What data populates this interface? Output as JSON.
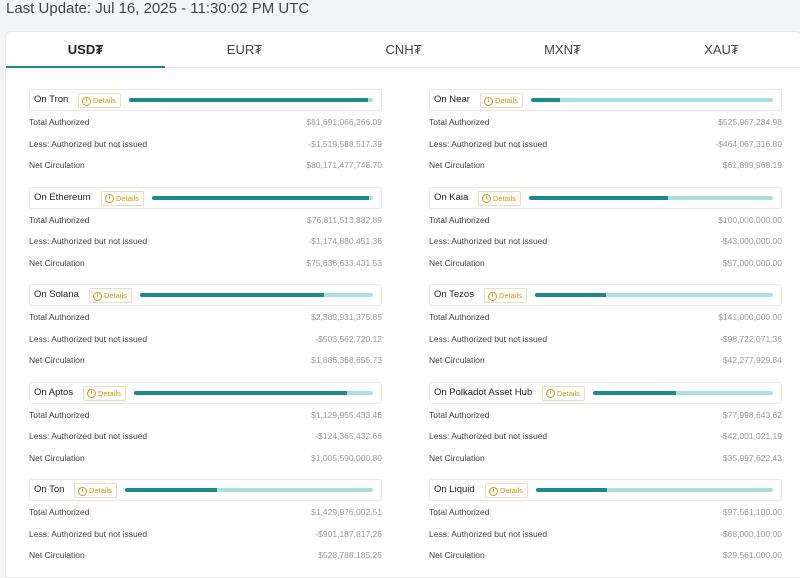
{
  "last_update": "Last Update: Jul 16, 2025 - 11:30:02 PM UTC",
  "tabs": [
    "USD₮",
    "EUR₮",
    "CNH₮",
    "MXN₮",
    "XAU₮"
  ],
  "active_tab": 0,
  "row_labels": {
    "total": "Total Authorized",
    "less": "Less: Authorized but not issued",
    "net": "Net Circulation"
  },
  "details_label": "Details",
  "colors": {
    "accent": "#1a8a8c",
    "accent_light": "#a9dfde",
    "details": "#c79a2e"
  },
  "chains_left": [
    {
      "name": "On Tron",
      "total": "$81,691,066,266.09",
      "less": "-$1,519,588,517.39",
      "net": "$80,171,477,748.70",
      "ratio": 0.98
    },
    {
      "name": "On Ethereum",
      "total": "$76,811,513,882.89",
      "less": "-$1,174,880,451.36",
      "net": "$75,636,633,431.53",
      "ratio": 0.98
    },
    {
      "name": "On Solana",
      "total": "$2,389,931,375.85",
      "less": "-$503,562,720.12",
      "net": "$1,886,368,655.73",
      "ratio": 0.79
    },
    {
      "name": "On Aptos",
      "total": "$1,129,955,433.46",
      "less": "-$124,365,432.66",
      "net": "$1,005,590,000.80",
      "ratio": 0.89
    },
    {
      "name": "On Ton",
      "total": "$1,429,976,002.51",
      "less": "-$901,187,817.26",
      "net": "$528,788,185.25",
      "ratio": 0.37
    }
  ],
  "chains_right": [
    {
      "name": "On Near",
      "total": "$525,967,284.98",
      "less": "-$464,067,316.80",
      "net": "$61,899,968.19",
      "ratio": 0.12
    },
    {
      "name": "On Kaia",
      "total": "$100,000,000.00",
      "less": "-$43,000,000.00",
      "net": "$57,000,000.00",
      "ratio": 0.57
    },
    {
      "name": "On Tezos",
      "total": "$141,000,000.00",
      "less": "-$98,722,071.36",
      "net": "$42,277,929.84",
      "ratio": 0.3
    },
    {
      "name": "On Polkadot Asset Hub",
      "total": "$77,998,643.62",
      "less": "-$42,001,021.19",
      "net": "$35,997,622.43",
      "ratio": 0.46
    },
    {
      "name": "On Liquid",
      "total": "$97,561,100.00",
      "less": "-$68,000,100.00",
      "net": "$29,561,000.00",
      "ratio": 0.3
    }
  ]
}
